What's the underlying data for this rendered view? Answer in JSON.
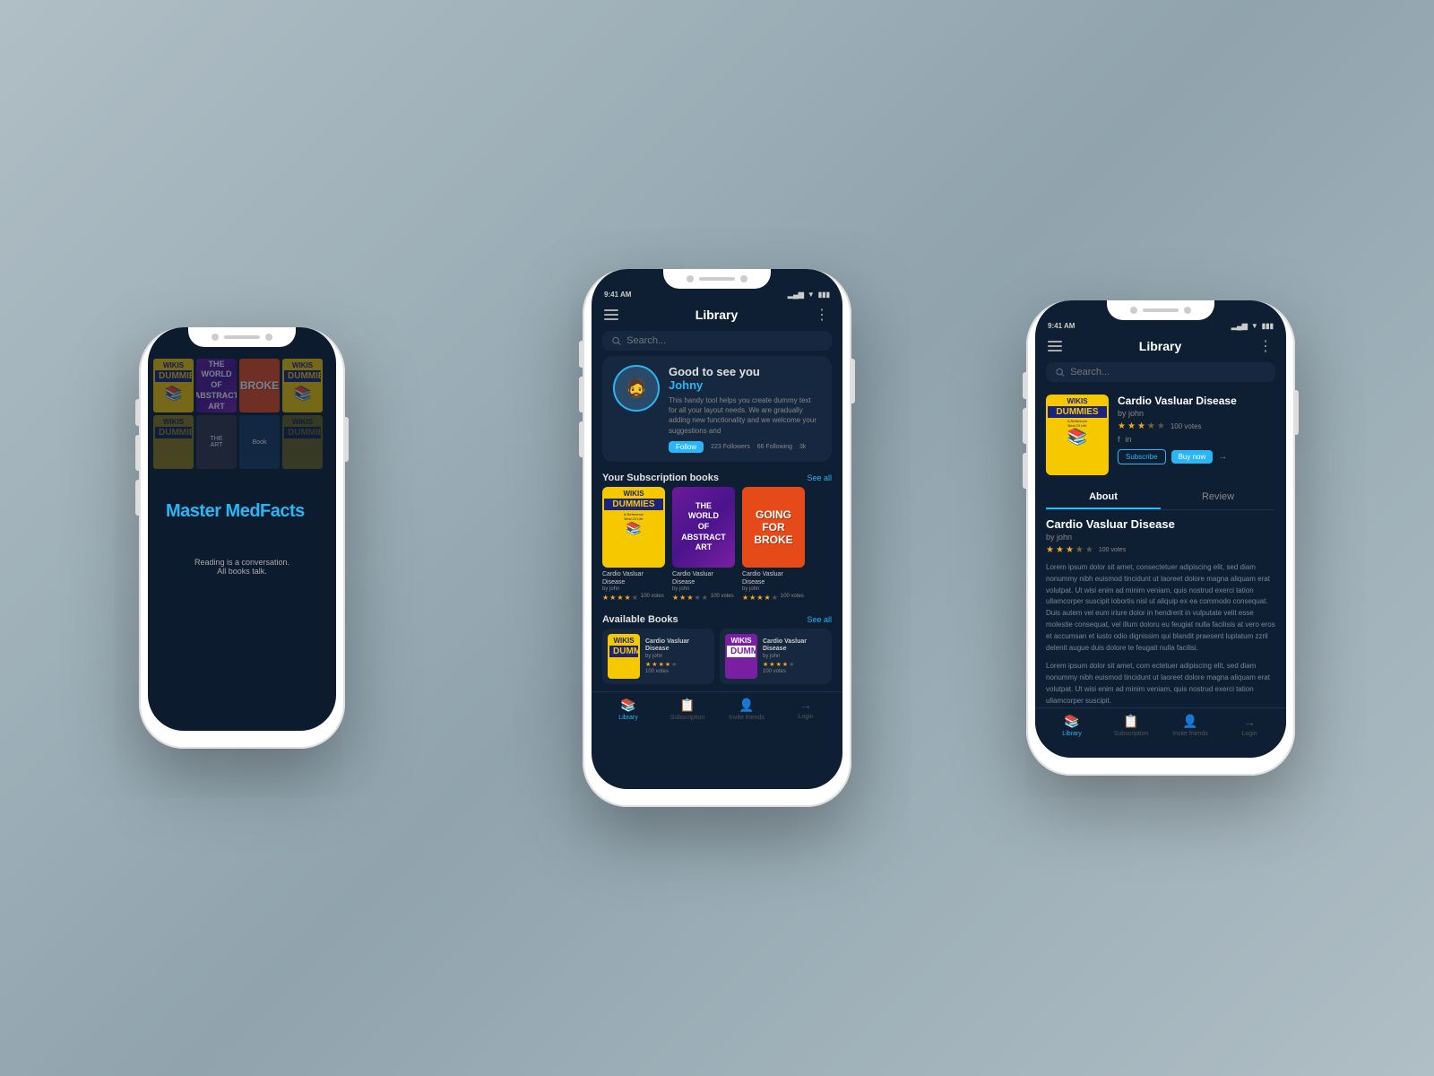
{
  "app": {
    "name": "Master MedFacts",
    "name_part1": "Master ",
    "name_part2": "MedFacts",
    "tagline_line1": "Reading is a conversation.",
    "tagline_line2": "All books talk."
  },
  "phone1": {
    "splash_logo": "Master MedFacts",
    "tagline": "Reading is a conversation.\nAll books talk."
  },
  "phone2": {
    "status_time": "9:41 AM",
    "header_title": "Library",
    "search_placeholder": "Search...",
    "greeting": "Good to see you",
    "user_name": "Johny",
    "profile_desc": "This handy tool helps you create dummy text for all your layout needs. We are gradually adding new functionality and we welcome your suggestions and",
    "follow_label": "Follow",
    "followers": "223 Followers",
    "following": "66 Following",
    "likes": "3k",
    "subscription_section": "Your Subscription books",
    "see_all_1": "See all",
    "available_section": "Available Books",
    "see_all_2": "See all",
    "books": [
      {
        "title": "Cardio Vasluar Disease",
        "author": "by john",
        "stars": 4,
        "votes": "100 votes",
        "type": "wikis"
      },
      {
        "title": "Cardio Vasluar Disease",
        "author": "by john",
        "stars": 3,
        "votes": "100 votes",
        "type": "abstract"
      },
      {
        "title": "Cardio Vasluar Disease",
        "author": "by john",
        "stars": 4,
        "votes": "100 votes",
        "type": "broke"
      }
    ],
    "available_books": [
      {
        "title": "Cardio Vasluar Disease",
        "author": "by john",
        "stars": 4,
        "votes": "100 votes",
        "type": "wikis"
      },
      {
        "title": "Cardio Vasluar Disease",
        "author": "by john",
        "stars": 4,
        "votes": "100 votes",
        "type": "wikis2"
      }
    ],
    "nav": [
      "Library",
      "Subscription",
      "Invite friends",
      "Login"
    ]
  },
  "phone3": {
    "status_time": "9:41 AM",
    "header_title": "Library",
    "search_placeholder": "Search...",
    "book_title": "Cardio Vasluar Disease",
    "book_author": "by john",
    "stars": 3.5,
    "votes": "100 votes",
    "subscribe_label": "Subscribe",
    "buy_label": "Buy now",
    "tab_about": "About",
    "tab_review": "Review",
    "detail_title": "Cardio Vasluar Disease",
    "detail_author": "by john",
    "lorem1": "Lorem ipsum dolor sit amet, consectetuer adipiscing elit, sed diam nonummy nibh euismod tincidunt ut laoreet dolore magna aliquam erat volutpat. Ut wisi enim ad minim veniam, quis nostrud exerci tation ullamcorper suscipit lobortis nisl ut aliquip ex ea commodo consequat. Duis autem vel eum iriure dolor in hendrerit in vulputate velit esse molestie consequat, vel illum doloru eu feugiat nulla facilisis at vero eros et accumsan et iusto odio dignissim qui blandit praesent luptatum zzril delenit augue duis dolore te feugait nulla facilisi.",
    "lorem2": "Lorem ipsum dolor sit amet, com ectetuer adipiscing elit, sed diam nonummy nibh euismod tincidunt ut laoreet dolore magna aliquam erat volutpat. Ut wisi enim ad minim veniam, quis nostrud exerci tation ullamcorper suscipit.",
    "nav": [
      "Library",
      "Subscription",
      "Invite friends",
      "Login"
    ]
  },
  "colors": {
    "accent": "#29b6f6",
    "dark_bg": "#0f1f33",
    "card_bg": "#162840",
    "star_color": "#f5a623",
    "text_primary": "#ffffff",
    "text_secondary": "#888888"
  }
}
